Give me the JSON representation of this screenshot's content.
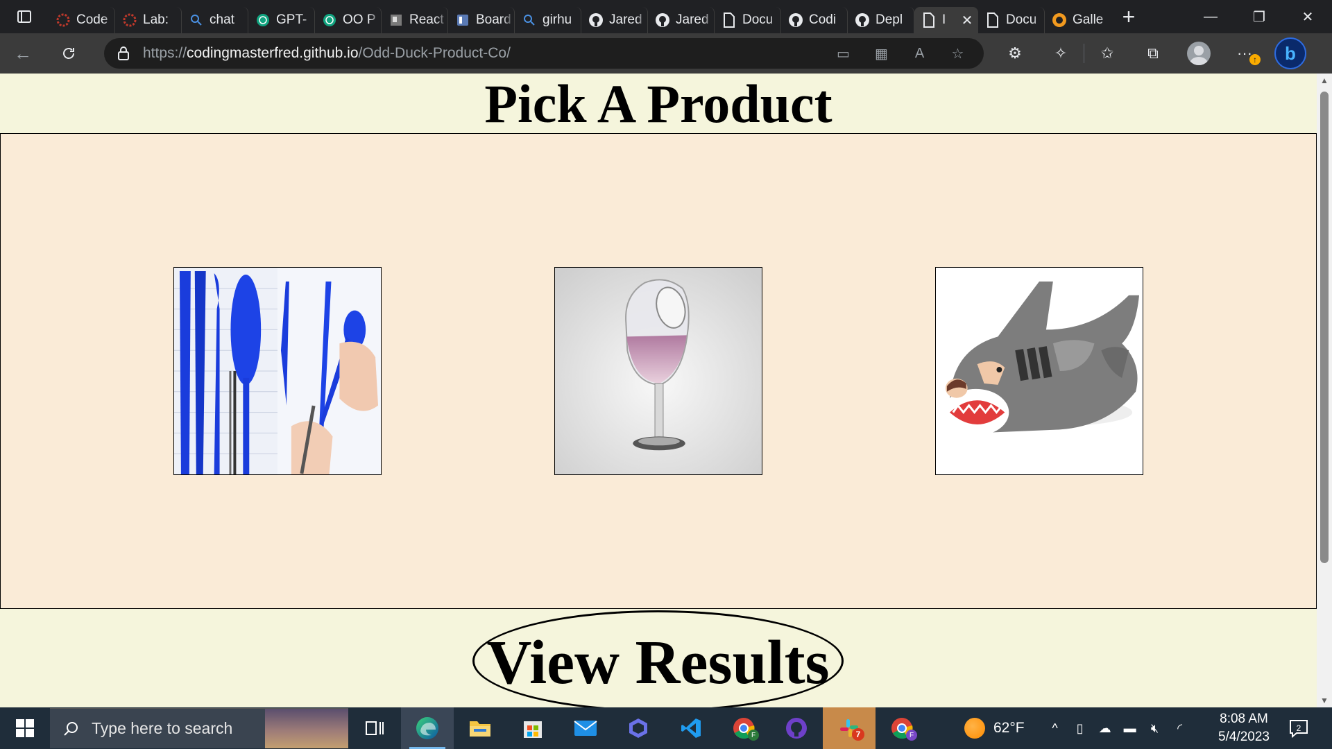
{
  "browser": {
    "tabs": [
      {
        "title": "Code",
        "icon": "codefellows-icon"
      },
      {
        "title": "Lab: ",
        "icon": "codefellows-icon"
      },
      {
        "title": "chat",
        "icon": "search-icon"
      },
      {
        "title": "GPT-",
        "icon": "openai-icon"
      },
      {
        "title": "OO P",
        "icon": "openai-icon"
      },
      {
        "title": "React",
        "icon": "page-icon"
      },
      {
        "title": "Board",
        "icon": "trello-icon"
      },
      {
        "title": "girhu",
        "icon": "search-icon"
      },
      {
        "title": "Jared",
        "icon": "github-icon"
      },
      {
        "title": "Jared",
        "icon": "github-icon"
      },
      {
        "title": "Docu",
        "icon": "document-icon"
      },
      {
        "title": "Codi",
        "icon": "github-icon"
      },
      {
        "title": "Depl",
        "icon": "github-icon"
      },
      {
        "title": "I",
        "icon": "document-icon",
        "active": true
      },
      {
        "title": "Docu",
        "icon": "document-icon"
      },
      {
        "title": "Galle",
        "icon": "gallery-icon"
      }
    ],
    "url_scheme": "https://",
    "url_host": "codingmasterfred.github.io",
    "url_path": "/Odd-Duck-Product-Co/",
    "update_badge": "↑"
  },
  "page": {
    "title": "Pick A Product",
    "products": [
      {
        "alt": "Blue plastic utensils and pens"
      },
      {
        "alt": "Wine glass with hole"
      },
      {
        "alt": "Shark sleeping bag"
      }
    ],
    "results_button": "View Results",
    "background_color": "#f5f5dc",
    "product_area_color": "#faebd7"
  },
  "taskbar": {
    "search_placeholder": "Type here to search",
    "temperature": "62°F",
    "time": "8:08 AM",
    "date": "5/4/2023",
    "slack_badge": "7",
    "chrome_badge": "F",
    "notifications": "2"
  }
}
